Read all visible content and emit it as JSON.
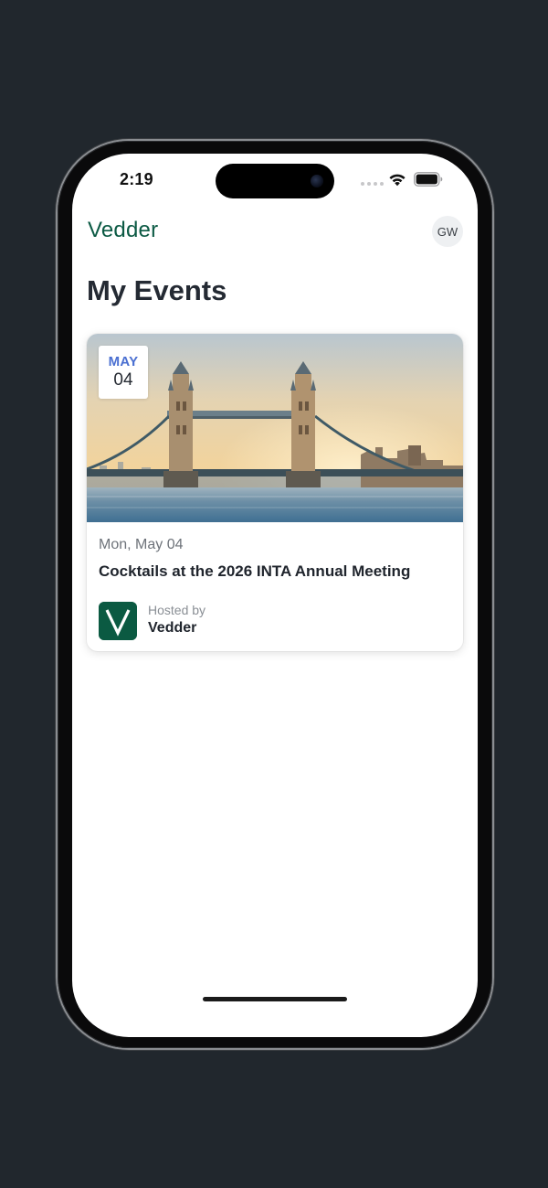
{
  "status_bar": {
    "time": "2:19",
    "icons": [
      "signal-dots",
      "wifi-icon",
      "battery-icon"
    ]
  },
  "header": {
    "brand": "Vedder",
    "avatar_initials": "GW",
    "brand_color": "#0c5a44"
  },
  "page": {
    "title": "My Events"
  },
  "events": [
    {
      "badge_month": "MAY",
      "badge_day": "04",
      "date": "Mon, May 04",
      "title": "Cocktails at the 2026 INTA Annual Meeting",
      "hosted_by_label": "Hosted by",
      "host_name": "Vedder",
      "host_logo_letter": "V",
      "image": "tower-bridge-photo"
    }
  ],
  "colors": {
    "accent_month": "#4a6fd1",
    "host_logo_bg": "#0b5a42",
    "background": "#21272d"
  }
}
